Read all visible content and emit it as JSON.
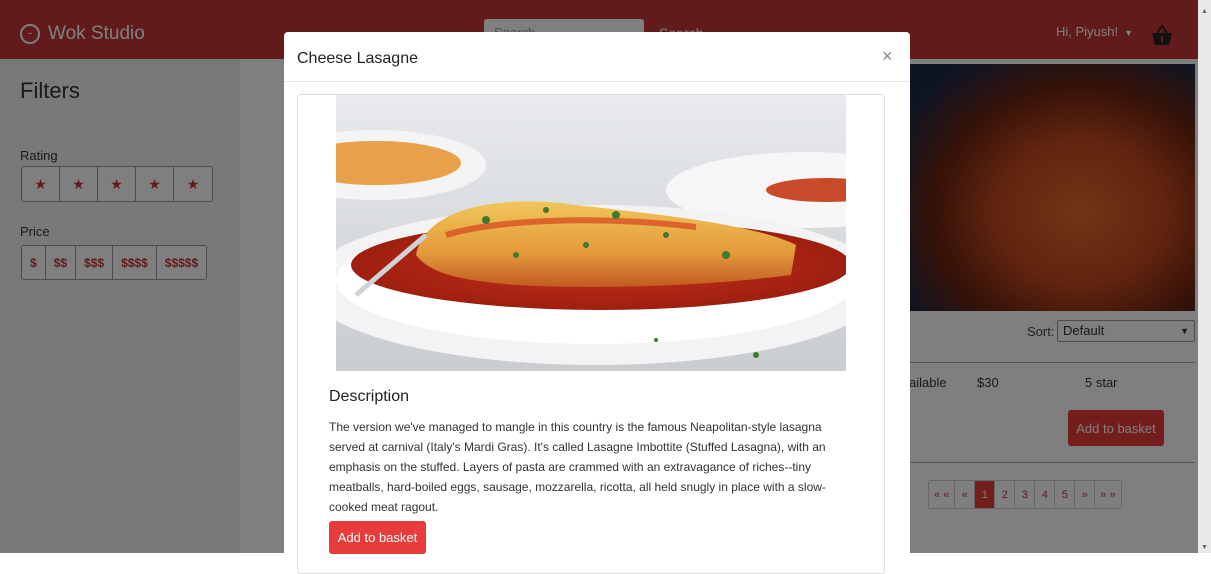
{
  "navbar": {
    "brand": "Wok Studio",
    "search_placeholder": "Search...",
    "search_button": "Search",
    "user_greeting": "Hi, Piyush!",
    "caret": "▼",
    "basket_icon": "basket-icon",
    "color": "#c23636"
  },
  "filters": {
    "title": "Filters",
    "rating_label": "Rating",
    "stars": [
      "★",
      "★",
      "★",
      "★",
      "★"
    ],
    "price_label": "Price",
    "prices": [
      "$",
      "$$",
      "$$$",
      "$$$$",
      "$$$$$"
    ]
  },
  "listing": {
    "sort_label": "Sort:",
    "sort_value": "Default",
    "sort_arrow": "▼",
    "availability": "ailable",
    "price": "$30",
    "rating": "5 star",
    "add_button": "Add to basket",
    "pagination": [
      "« «",
      "«",
      "1",
      "2",
      "3",
      "4",
      "5",
      "»",
      "» »"
    ],
    "active_page": "1"
  },
  "modal": {
    "title": "Cheese Lasagne",
    "close": "×",
    "description_title": "Description",
    "description": "The version we've managed to mangle in this country is the famous Neapolitan-style lasagna served at carnival (Italy's Mardi Gras). It's called Lasagne Imbottite (Stuffed Lasagna), with an emphasis on the stuffed. Layers of pasta are crammed with an extravagance of riches--tiny meatballs, hard-boiled eggs, sausage, mozzarella, ricotta, all held snugly in place with a slow-cooked meat ragout.",
    "add_button": "Add to basket",
    "accent_color": "#e83b3b"
  },
  "scrollbar": {
    "up": "▲",
    "down": "▼"
  }
}
